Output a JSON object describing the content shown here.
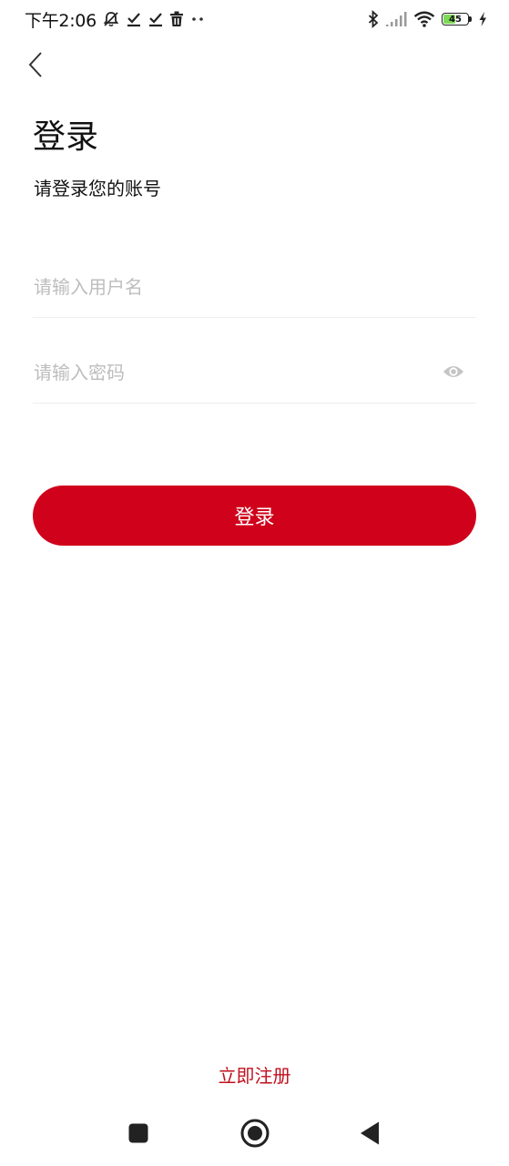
{
  "status_bar": {
    "time": "下午2:06",
    "battery_level": "45",
    "icons": [
      "mute-notification-icon",
      "download-done-icon",
      "download-done-icon",
      "trash-icon",
      "more-dots-icon",
      "bluetooth-icon",
      "signal-icon",
      "wifi-icon",
      "battery-icon",
      "charging-icon"
    ]
  },
  "header": {
    "title": "登录",
    "subtitle": "请登录您的账号"
  },
  "form": {
    "username": {
      "value": "",
      "placeholder": "请输入用户名"
    },
    "password": {
      "value": "",
      "placeholder": "请输入密码"
    },
    "login_label": "登录"
  },
  "footer": {
    "register_label": "立即注册"
  },
  "colors": {
    "accent": "#d0021b",
    "link": "#c0111f",
    "placeholder": "#bdbdbd",
    "divider": "#eeeeee",
    "battery": "#7ed957"
  },
  "nav_bar": {
    "icons": [
      "recent-apps-icon",
      "home-icon",
      "back-triangle-icon"
    ]
  }
}
